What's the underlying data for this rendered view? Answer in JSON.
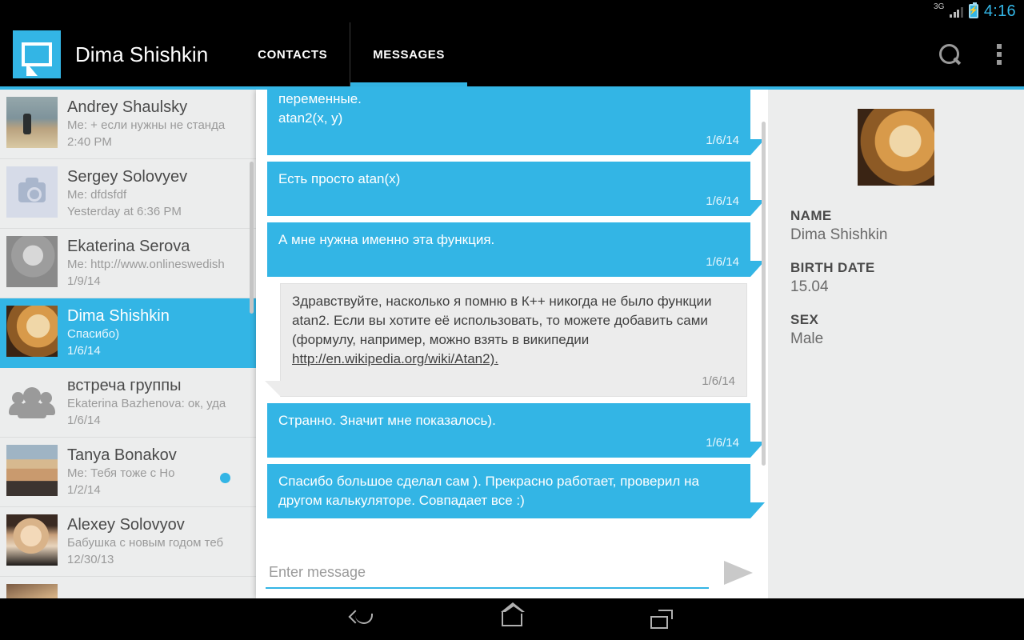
{
  "statusbar": {
    "network": "3G",
    "time": "4:16",
    "battery_icon": "battery-charging-icon",
    "signal_icon": "signal-bars-icon"
  },
  "actionbar": {
    "app_title": "Dima Shishkin",
    "logo_icon": "speech-bubble-logo",
    "tabs": [
      {
        "label": "CONTACTS",
        "active": false
      },
      {
        "label": "MESSAGES",
        "active": true
      }
    ],
    "search_icon": "search-icon",
    "overflow_icon": "overflow-menu-icon"
  },
  "sidebar": {
    "conversations": [
      {
        "name": "Andrey Shaulsky",
        "snippet": "Me: + если нужны не станда",
        "time": "2:40 PM",
        "avatar": "photo-andrey",
        "selected": false,
        "unread": false
      },
      {
        "name": "Sergey Solovyev",
        "snippet": "Me: dfdsfdf",
        "time": "Yesterday at 6:36 PM",
        "avatar": "camera-placeholder-icon",
        "selected": false,
        "unread": false
      },
      {
        "name": "Ekaterina Serova",
        "snippet": "Me: http://www.onlineswedish",
        "time": "1/9/14",
        "avatar": "photo-ekaterina",
        "selected": false,
        "unread": false
      },
      {
        "name": "Dima Shishkin",
        "snippet": "Спасибо)",
        "time": "1/6/14",
        "avatar": "photo-tiger",
        "selected": true,
        "unread": false
      },
      {
        "name": "встреча группы",
        "snippet": "Ekaterina Bazhenova: ок, уда",
        "time": "1/6/14",
        "avatar": "group-people-icon",
        "selected": false,
        "unread": false
      },
      {
        "name": "Tanya Bonakov",
        "snippet": "Me: Тебя тоже с Но",
        "time": "1/2/14",
        "avatar": "photo-tanya",
        "selected": false,
        "unread": true
      },
      {
        "name": "Alexey Solovyov",
        "snippet": "Бабушка с новым годом теб",
        "time": "12/30/13",
        "avatar": "photo-alexey",
        "selected": false,
        "unread": false
      }
    ]
  },
  "chat": {
    "messages": [
      {
        "direction": "out",
        "text": "переменные.\natan2(x, y)",
        "time": "1/6/14",
        "clipped": true
      },
      {
        "direction": "out",
        "text": "Есть просто atan(x)",
        "time": "1/6/14",
        "clipped": false
      },
      {
        "direction": "out",
        "text": "А мне нужна именно эта функция.",
        "time": "1/6/14",
        "clipped": false
      },
      {
        "direction": "in",
        "text": "Здравствуйте, насколько я помню в К++ никогда не было функции atan2. Если вы хотите её использовать, то можете добавить сами (формулу, например, можно взять в википедии ",
        "link": "http://en.wikipedia.org/wiki/Atan2).",
        "time": "1/6/14",
        "clipped": false
      },
      {
        "direction": "out",
        "text": "Странно. Значит мне показалось).",
        "time": "1/6/14",
        "clipped": false
      },
      {
        "direction": "out",
        "text": "Спасибо большое сделал сам ). Прекрасно работает, проверил на другом калькуляторе. Совпадает все :)",
        "time": "",
        "clipped": false
      }
    ],
    "composer": {
      "value": "",
      "placeholder": "Enter message",
      "send_icon": "send-arrow-icon"
    }
  },
  "info": {
    "avatar": "photo-tiger",
    "fields": [
      {
        "label": "NAME",
        "value": "Dima Shishkin"
      },
      {
        "label": "BIRTH DATE",
        "value": "15.04"
      },
      {
        "label": "SEX",
        "value": "Male"
      }
    ]
  },
  "navbar": {
    "back_icon": "back-icon",
    "home_icon": "home-icon",
    "recents_icon": "recent-apps-icon"
  },
  "colors": {
    "accent": "#33b5e5",
    "bar": "#000000",
    "panel": "#eceded",
    "incoming_bubble": "#ececec"
  }
}
